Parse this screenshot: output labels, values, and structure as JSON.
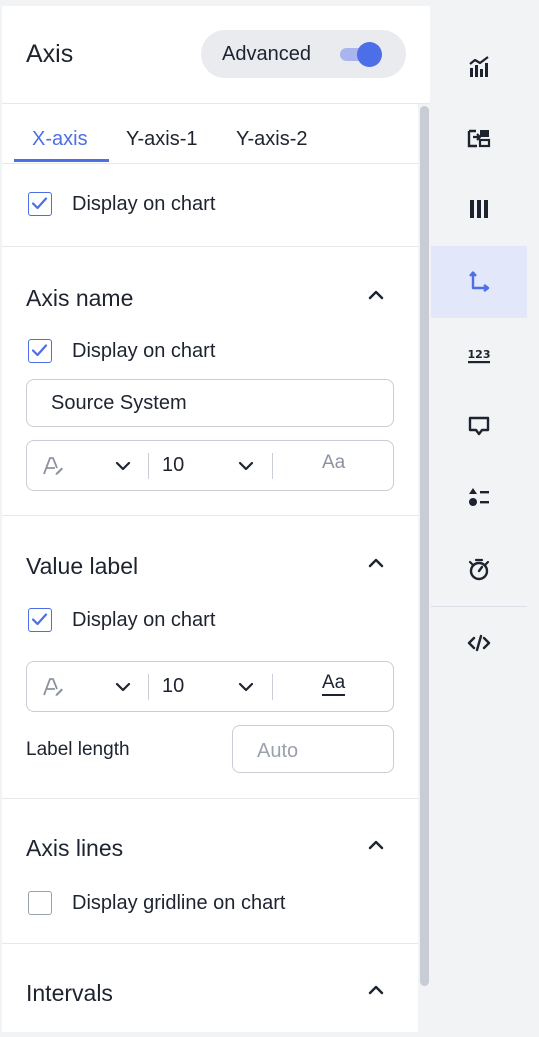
{
  "header": {
    "title": "Axis",
    "advanced_label": "Advanced",
    "advanced_on": true
  },
  "tabs": [
    {
      "label": "X-axis",
      "active": true
    },
    {
      "label": "Y-axis-1",
      "active": false
    },
    {
      "label": "Y-axis-2",
      "active": false
    }
  ],
  "display": {
    "label": "Display on chart",
    "checked": true
  },
  "axis_name": {
    "title": "Axis name",
    "display_label": "Display on chart",
    "display_checked": true,
    "name_value": "Source System",
    "font_size": "10",
    "case_label": "Aa"
  },
  "value_label": {
    "title": "Value label",
    "display_label": "Display on chart",
    "display_checked": true,
    "font_size": "10",
    "case_label": "Aa",
    "length_label": "Label length",
    "length_placeholder": "Auto"
  },
  "axis_lines": {
    "title": "Axis lines",
    "gridline_label": "Display gridline on chart",
    "gridline_checked": false
  },
  "intervals": {
    "title": "Intervals"
  },
  "rail": {
    "items": [
      {
        "icon": "chart-type-icon",
        "active": false
      },
      {
        "icon": "configure-icon",
        "active": false
      },
      {
        "icon": "columns-icon",
        "active": false
      },
      {
        "icon": "axis-icon",
        "active": true
      },
      {
        "icon": "number-format-icon",
        "active": false
      },
      {
        "icon": "tooltip-icon",
        "active": false
      },
      {
        "icon": "legend-icon",
        "active": false
      },
      {
        "icon": "goal-icon",
        "active": false
      },
      {
        "icon": "custom-code-icon",
        "active": false
      }
    ]
  },
  "colors": {
    "accent": "#4c6ee6",
    "text": "#1d232f",
    "border": "#c9ced6",
    "rail_active": "#e2e7f9"
  }
}
